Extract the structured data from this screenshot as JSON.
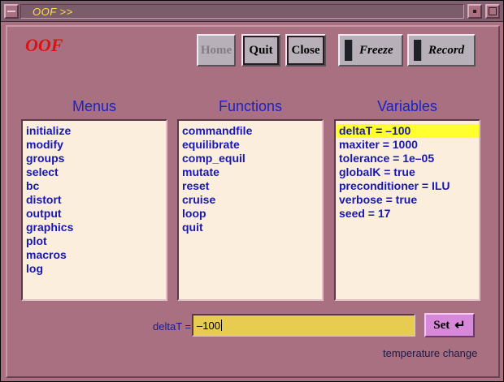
{
  "window": {
    "title": "OOF >>",
    "icons": {
      "menu": "window-menu-icon",
      "minimize": "minimize-icon",
      "maximize": "maximize-icon"
    }
  },
  "header": {
    "logo": "OOF",
    "buttons": {
      "home": "Home",
      "quit": "Quit",
      "close": "Close",
      "freeze": "Freeze",
      "record": "Record"
    }
  },
  "menus": {
    "heading": "Menus",
    "items": [
      "initialize",
      "modify",
      "groups",
      "select",
      "bc",
      "distort",
      "output",
      "graphics",
      "plot",
      "macros",
      "log"
    ]
  },
  "functions": {
    "heading": "Functions",
    "items": [
      "commandfile",
      "equilibrate",
      "comp_equil",
      "mutate",
      "reset",
      "cruise",
      "loop",
      "quit"
    ]
  },
  "variables": {
    "heading": "Variables",
    "items": [
      "deltaT = –100",
      "maxiter = 1000",
      "tolerance = 1e–05",
      "globalK = true",
      "preconditioner = ILU",
      "verbose = true",
      "seed = 17"
    ],
    "selected_index": 0
  },
  "editor": {
    "label": "deltaT =",
    "value": "–100",
    "set_label": "Set",
    "enter_icon": "enter-return-icon",
    "description": "temperature change"
  },
  "colors": {
    "background": "#a87080",
    "title_text": "#ffe040",
    "logo": "#e01010",
    "heading": "#1a22c8",
    "list_bg": "#fbeedd",
    "selection": "#ffff30",
    "field_bg": "#e8cc50",
    "set_button": "#d888d8"
  }
}
